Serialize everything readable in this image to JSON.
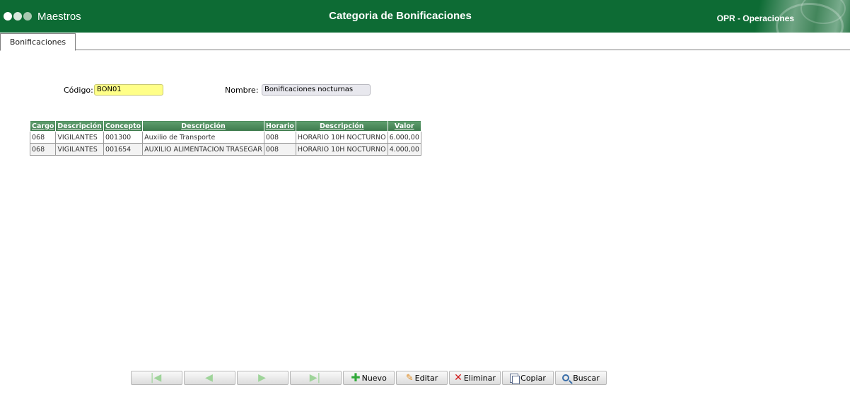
{
  "header": {
    "module": "Maestros",
    "title": "Categoria de Bonificaciones",
    "area": "OPR - Operaciones"
  },
  "tabs": [
    {
      "label": "Bonificaciones"
    }
  ],
  "form": {
    "codigo_label": "Código:",
    "codigo_value": "BON01",
    "nombre_label": "Nombre:",
    "nombre_value": "Bonificaciones nocturnas"
  },
  "grid": {
    "headers": [
      "Cargo",
      "Descripción",
      "Concepto",
      "Descripción",
      "Horario",
      "Descripción",
      "Valor"
    ],
    "rows": [
      [
        "068",
        "VIGILANTES",
        "001300",
        "Auxilio de Transporte",
        "008",
        "HORARIO 10H NOCTURNO",
        "6.000,00"
      ],
      [
        "068",
        "VIGILANTES",
        "001654",
        "AUXILIO ALIMENTACION TRASEGAR",
        "008",
        "HORARIO 10H NOCTURNO",
        "4.000,00"
      ]
    ]
  },
  "toolbar": {
    "nuevo": "Nuevo",
    "editar": "Editar",
    "eliminar": "Eliminar",
    "copiar": "Copiar",
    "buscar": "Buscar",
    "icons": [
      "first-icon",
      "prev-icon",
      "next-icon",
      "last-icon",
      "plus-icon",
      "pencil-icon",
      "delete-icon",
      "copy-icon",
      "search-icon"
    ]
  },
  "colors": {
    "header_bg": "#0d6b34",
    "grid_header": "#4a8a5a",
    "code_field": "#ffff88"
  }
}
